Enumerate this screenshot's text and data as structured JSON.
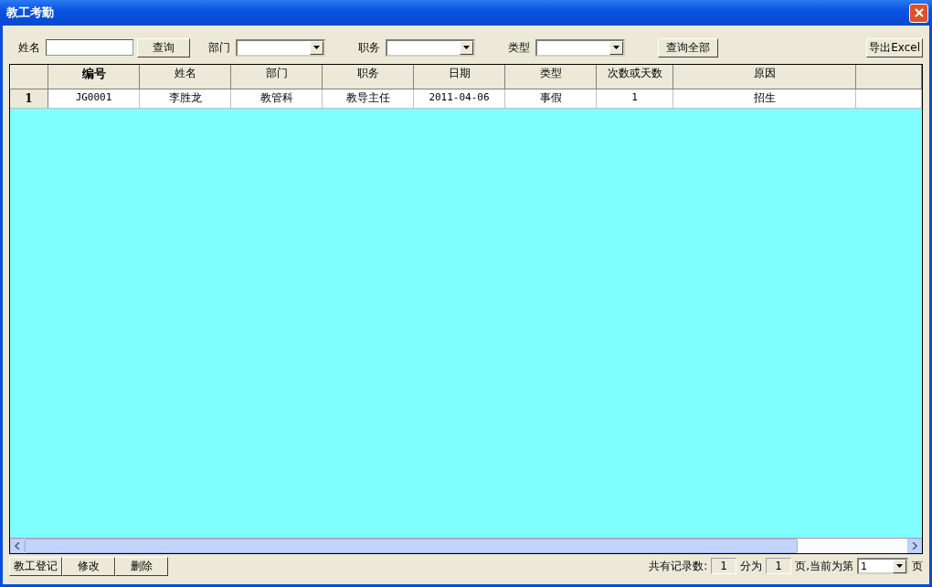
{
  "window": {
    "title": "教工考勤"
  },
  "toolbar": [
    {
      "kind": "label",
      "text": "姓名"
    },
    {
      "kind": "input"
    },
    {
      "kind": "button",
      "text": "查询"
    },
    {
      "kind": "label",
      "text": "部门"
    },
    {
      "kind": "select"
    },
    {
      "kind": "label",
      "text": "职务"
    },
    {
      "kind": "select"
    },
    {
      "kind": "label",
      "text": "类型"
    },
    {
      "kind": "select"
    },
    {
      "kind": "button",
      "text": "查询全部"
    },
    {
      "kind": "button",
      "text": "导出Excel"
    }
  ],
  "table": {
    "columns": [
      "编号",
      "姓名",
      "部门",
      "职务",
      "日期",
      "类型",
      "次数或天数",
      "原因"
    ],
    "rows": [
      {
        "number": "1",
        "cells": [
          "JG0001",
          "李胜龙",
          "教管科",
          "教导主任",
          "2011-04-06",
          "事假",
          "1",
          "招生"
        ]
      }
    ]
  },
  "actions": [
    "教工登记",
    "修改",
    "删除"
  ],
  "pager": {
    "total_label": "共有记录数:",
    "total": "1",
    "pages_label": "分为",
    "pages": "1",
    "current_label": "页,当前为第",
    "current": "1",
    "suffix": "页"
  }
}
